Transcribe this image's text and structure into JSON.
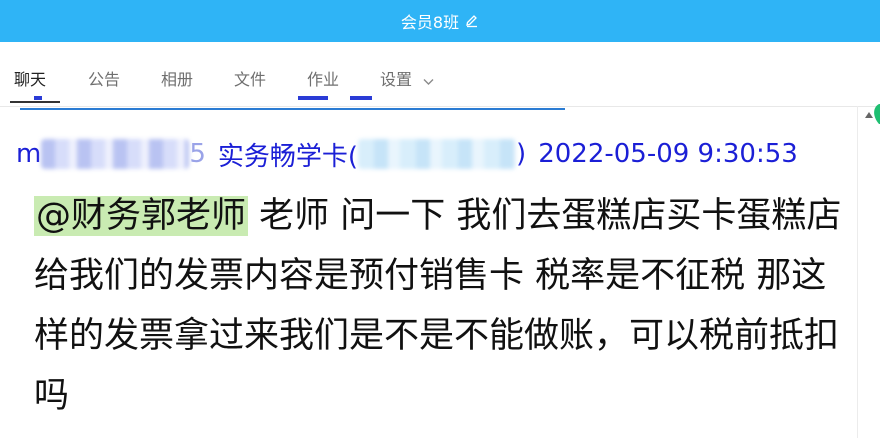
{
  "titlebar": {
    "title": "会员8班",
    "edit_icon": "pencil-icon"
  },
  "tabs": [
    {
      "label": "聊天",
      "active": true
    },
    {
      "label": "公告"
    },
    {
      "label": "相册"
    },
    {
      "label": "文件"
    },
    {
      "label": "作业"
    },
    {
      "label": "设置"
    }
  ],
  "message": {
    "sender_prefix": "m",
    "sender_id_tail": "5",
    "sender_name": "实务畅学卡(",
    "sender_close": ")",
    "timestamp": "2022-05-09 9:30:53",
    "mention": "@财务郭老师",
    "text": " 老师 问一下 我们去蛋糕店买卡蛋糕店给我们的发票内容是预付销售卡 税率是不征税 那这样的发票拿过来我们是不是不能做账，可以税前抵扣吗"
  },
  "colors": {
    "titlebar": "#2fb4f6",
    "sender": "#1b1fd6",
    "mention_bg": "#c9ebb2"
  }
}
